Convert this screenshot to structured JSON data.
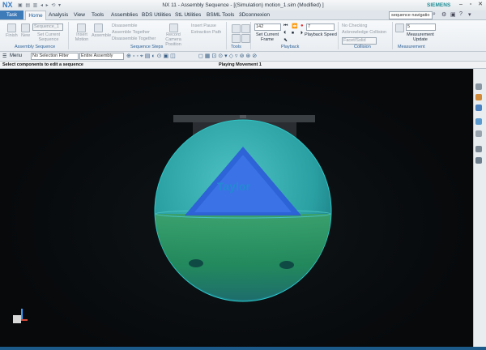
{
  "app": {
    "logo": "NX",
    "window_title": "NX 11 - Assembly Sequence - [(Simulation) motion_1.sim (Modified) ]",
    "brand": "SIEMENS"
  },
  "tabs": [
    "Task",
    "Home",
    "Analysis",
    "View",
    "Tools",
    "Assemblies",
    "BDS Utilities",
    "StL Utilities",
    "BSML Tools",
    "3Dconnexion"
  ],
  "search": {
    "value": "sequence navigatio"
  },
  "ribbon": {
    "finish": "Finish",
    "new": "New",
    "sequence_dropdown": "Sequence_1",
    "set_current_sequence": "Set Current Sequence",
    "insert_motion": "Insert Motion",
    "assemble": "Assemble",
    "disassemble": "Disassemble",
    "assemble_together": "Assemble Together",
    "disassemble_together": "Disassemble Together",
    "record_camera_position": "Record Camera Position",
    "insert_pause": "Insert Pause",
    "extraction_path": "Extraction Path",
    "frame_value": "142",
    "set_current_frame": "Set Current Frame",
    "speed_value": "7",
    "playback_speed": "Playback Speed",
    "no_checking": "No Checking",
    "acknowledge_collision": "Acknowledge Collision",
    "facet_solid": "Facet/Solid",
    "measure_value": "5",
    "measurement_update": "Measurement Update",
    "groups": {
      "assembly_sequence": "Assembly Sequence",
      "sequence_steps": "Sequence Steps",
      "tools": "Tools",
      "playback": "Playback",
      "collision": "Collision",
      "measurement": "Measurement"
    }
  },
  "selection_bar": {
    "menu": "Menu",
    "filter": "No Selection Filter",
    "scope": "Entire Assembly"
  },
  "status": {
    "left": "Select components to edit a sequence",
    "center": "Playing Movement 1"
  },
  "model": {
    "engraved_text": "Taylor"
  },
  "colors": {
    "accent": "#3d7ab8",
    "brand": "#1a8c94",
    "sphere": "#2fa7a8",
    "triangle": "#2c5fd8",
    "lid": "#2e3236"
  }
}
